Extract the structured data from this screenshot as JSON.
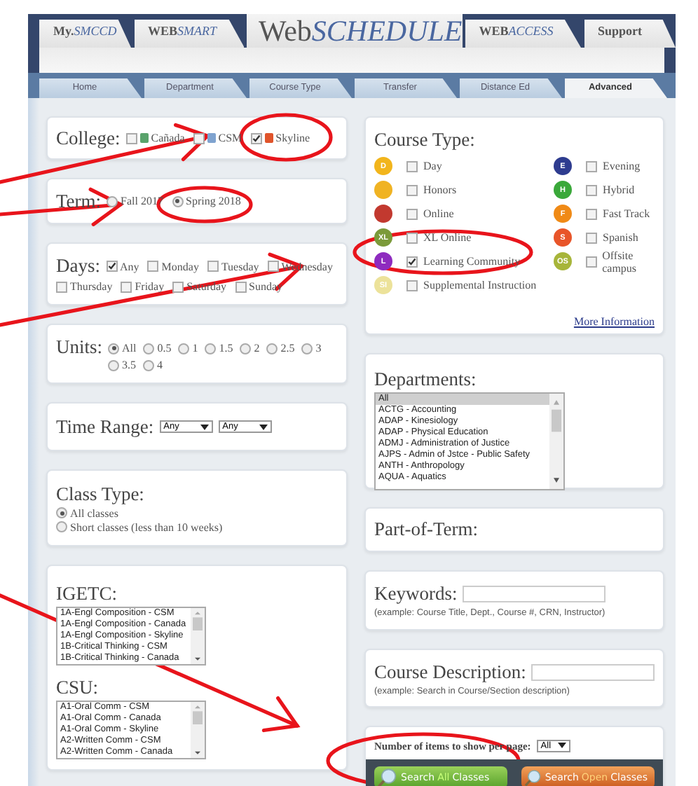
{
  "header": {
    "tabs": [
      {
        "parts": [
          "My.",
          "SMCCD"
        ],
        "selected": false
      },
      {
        "parts": [
          "WEB",
          "SMART"
        ],
        "selected": false
      },
      {
        "parts": [
          "Web",
          "SCHEDULE"
        ],
        "selected": true
      },
      {
        "parts": [
          "WEB",
          "ACCESS"
        ],
        "selected": false
      },
      {
        "parts": [
          "Support"
        ],
        "selected": false
      }
    ]
  },
  "nav_tabs": [
    {
      "label": "Home",
      "selected": false
    },
    {
      "label": "Department",
      "selected": false
    },
    {
      "label": "Course Type",
      "selected": false
    },
    {
      "label": "Transfer",
      "selected": false
    },
    {
      "label": "Distance Ed",
      "selected": false
    },
    {
      "label": "Advanced",
      "selected": true
    }
  ],
  "college": {
    "label": "College:",
    "options": [
      {
        "label": "Cañada",
        "checked": false,
        "color": "#5aa36c"
      },
      {
        "label": "CSM",
        "checked": false,
        "color": "#7fa3cf"
      },
      {
        "label": "Skyline",
        "checked": true,
        "color": "#e0542b"
      }
    ]
  },
  "term": {
    "label": "Term:",
    "options": [
      {
        "label": "Fall 2017",
        "selected": false
      },
      {
        "label": "Spring 2018",
        "selected": true
      }
    ]
  },
  "days": {
    "label": "Days:",
    "options": [
      {
        "label": "Any",
        "checked": true
      },
      {
        "label": "Monday",
        "checked": false
      },
      {
        "label": "Tuesday",
        "checked": false
      },
      {
        "label": "Wednesday",
        "checked": false
      },
      {
        "label": "Thursday",
        "checked": false
      },
      {
        "label": "Friday",
        "checked": false
      },
      {
        "label": "Saturday",
        "checked": false
      },
      {
        "label": "Sunday",
        "checked": false
      }
    ]
  },
  "units": {
    "label": "Units:",
    "options": [
      {
        "label": "All",
        "selected": true
      },
      {
        "label": "0.5",
        "selected": false
      },
      {
        "label": "1",
        "selected": false
      },
      {
        "label": "1.5",
        "selected": false
      },
      {
        "label": "2",
        "selected": false
      },
      {
        "label": "2.5",
        "selected": false
      },
      {
        "label": "3",
        "selected": false
      },
      {
        "label": "3.5",
        "selected": false
      },
      {
        "label": "4",
        "selected": false
      }
    ]
  },
  "time_range": {
    "label": "Time Range:",
    "from": "Any",
    "to": "Any"
  },
  "class_type": {
    "label": "Class Type:",
    "options": [
      {
        "label": "All classes",
        "selected": true
      },
      {
        "label": "Short classes (less than 10 weeks)",
        "selected": false
      }
    ]
  },
  "igetc": {
    "label": "IGETC:",
    "items": [
      "1A-Engl Composition - CSM",
      "1A-Engl Composition - Canada",
      "1A-Engl Composition - Skyline",
      "1B-Critical Thinking - CSM",
      "1B-Critical Thinking - Canada"
    ]
  },
  "csu": {
    "label": "CSU:",
    "items": [
      "A1-Oral Comm - CSM",
      "A1-Oral Comm - Canada",
      "A1-Oral Comm - Skyline",
      "A2-Written Comm - CSM",
      "A2-Written Comm - Canada"
    ]
  },
  "course_type": {
    "label": "Course Type:",
    "options": [
      {
        "label": "Day",
        "badge": "D",
        "color": "#f2b51c",
        "checked": false
      },
      {
        "label": "Evening",
        "badge": "E",
        "color": "#2e3c8f",
        "checked": false
      },
      {
        "label": "Honors",
        "color": "#f0b323",
        "checked": false
      },
      {
        "label": "Hybrid",
        "badge": "H",
        "color": "#3aa83a",
        "checked": false
      },
      {
        "label": "Online",
        "color": "#c2392f",
        "checked": false
      },
      {
        "label": "Fast Track",
        "badge": "F",
        "color": "#f08a16",
        "checked": false
      },
      {
        "label": "XL Online",
        "badge": "XL",
        "color": "#7b9a3a",
        "checked": false
      },
      {
        "label": "Spanish",
        "badge": "S",
        "color": "#e8552a",
        "checked": false
      },
      {
        "label": "Learning Community",
        "badge": "L",
        "color": "#8e2bbf",
        "checked": true
      },
      {
        "label": "Offsite campus",
        "badge": "OS",
        "color": "#a7b53a",
        "checked": false
      },
      {
        "label": "Supplemental Instruction",
        "badge": "SI",
        "color": "#ece29a",
        "checked": false
      }
    ],
    "link": "More Information"
  },
  "departments": {
    "label": "Departments:",
    "items": [
      {
        "label": "All",
        "selected": true
      },
      {
        "label": "ACTG - Accounting",
        "selected": false
      },
      {
        "label": "ADAP - Kinesiology",
        "selected": false
      },
      {
        "label": "ADAP - Physical Education",
        "selected": false
      },
      {
        "label": "ADMJ - Administration of Justice",
        "selected": false
      },
      {
        "label": "AJPS - Admin of Jstce - Public Safety",
        "selected": false
      },
      {
        "label": "ANTH - Anthropology",
        "selected": false
      },
      {
        "label": "AQUA - Aquatics",
        "selected": false
      }
    ]
  },
  "part_of_term": {
    "label": "Part-of-Term:"
  },
  "keywords": {
    "label": "Keywords:",
    "hint": "(example: Course Title, Dept., Course #, CRN, Instructor)"
  },
  "course_description": {
    "label": "Course Description:",
    "hint": "(example: Search in Course/Section description)"
  },
  "per_page": {
    "label": "Number of items to show per page:",
    "value": "All"
  },
  "buttons": [
    {
      "kind": "all",
      "parts": [
        "Search",
        "All",
        "Classes"
      ]
    },
    {
      "kind": "open",
      "parts": [
        "Search",
        "Open",
        "Classes"
      ]
    }
  ]
}
